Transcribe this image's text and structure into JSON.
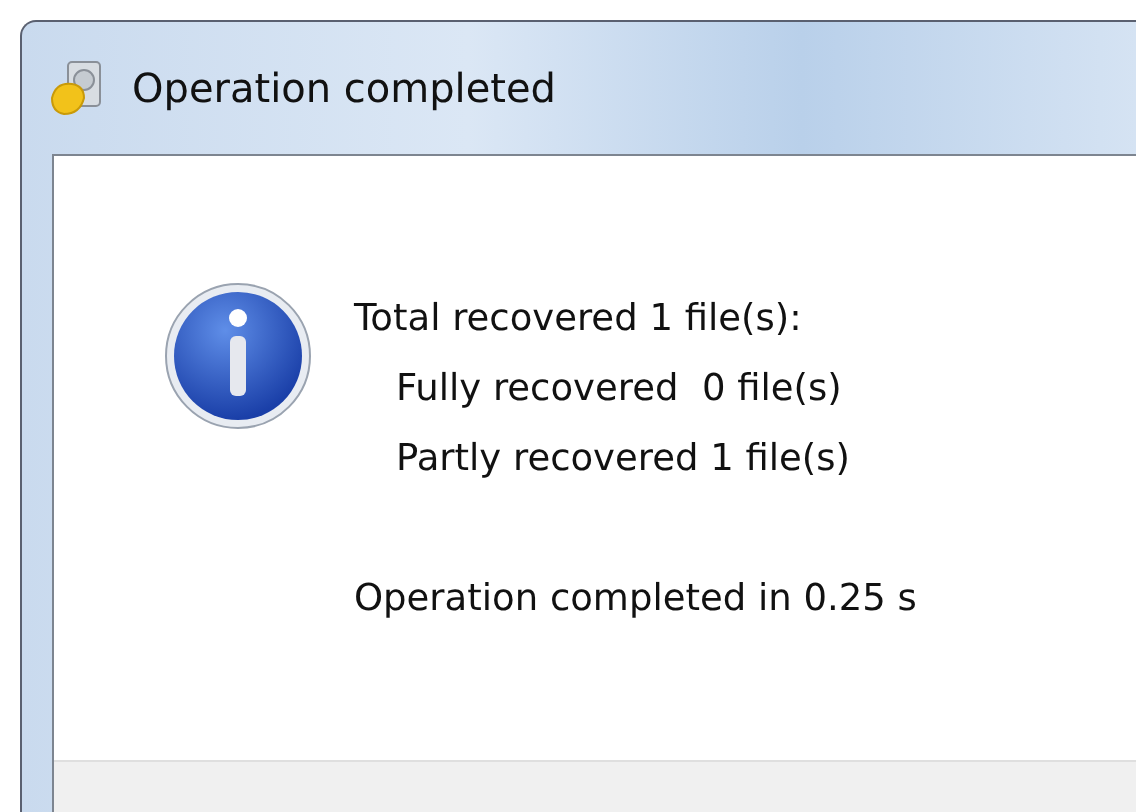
{
  "window": {
    "title": "Operation completed"
  },
  "message": {
    "lines": [
      {
        "text": "Total recovered 1 file(s):",
        "indented": false
      },
      {
        "text": "Fully recovered  0 file(s)",
        "indented": true
      },
      {
        "text": "Partly recovered 1 file(s)",
        "indented": true
      }
    ],
    "summary": "Operation completed in 0.25 s"
  }
}
